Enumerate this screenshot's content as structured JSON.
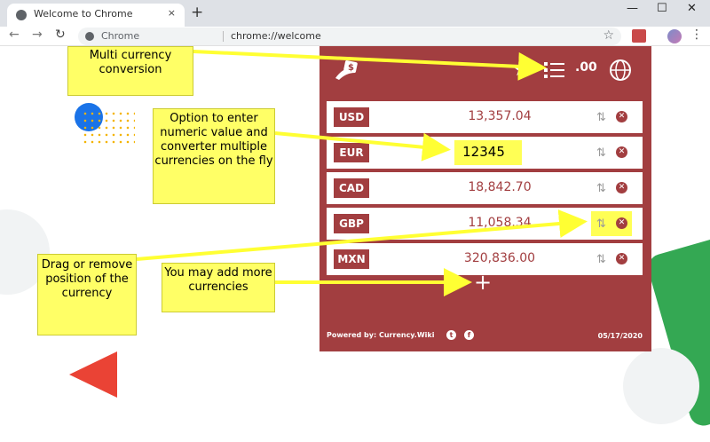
{
  "browser": {
    "tab_title": "Welcome to Chrome",
    "tab_close": "×",
    "new_tab": "+",
    "minimize": "—",
    "maximize": "☐",
    "close": "✕",
    "back": "←",
    "forward": "→",
    "reload": "↻",
    "omnibox_label": "Chrome",
    "omnibox_url": "chrome://welcome",
    "bookmark_star": "☆",
    "menu": "⋮"
  },
  "extension": {
    "header_star": "★",
    "decimals_label": ".00",
    "currencies": [
      {
        "code": "USD",
        "amount": "13,357.04"
      },
      {
        "code": "EUR",
        "amount": "12345"
      },
      {
        "code": "CAD",
        "amount": "18,842.70"
      },
      {
        "code": "GBP",
        "amount": "11,058.34"
      },
      {
        "code": "MXN",
        "amount": "320,836.00"
      }
    ],
    "add_button": "+",
    "powered_by": "Powered by: Currency.Wiki",
    "date": "05/17/2020",
    "brand_color": "#a23e40"
  },
  "callouts": {
    "multi_currency": "Multi currency conversion",
    "enter_value": "Option to enter numeric value and converter multiple currencies on the fly",
    "drag_remove": "Drag or remove position of the currency",
    "add_more": "You may add more currencies"
  },
  "colors": {
    "callout_bg": "#ffff66",
    "google_blue": "#1a73e8",
    "google_red": "#ea4335",
    "google_green": "#34a853",
    "google_yellow": "#f4b400"
  }
}
